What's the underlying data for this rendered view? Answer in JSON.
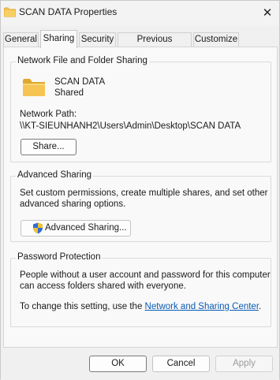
{
  "window": {
    "title": "SCAN DATA Properties",
    "close_glyph": "✕"
  },
  "tabs": [
    {
      "label": "General",
      "active": false
    },
    {
      "label": "Sharing",
      "active": true
    },
    {
      "label": "Security",
      "active": false
    },
    {
      "label": "Previous Versions",
      "active": false
    },
    {
      "label": "Customize",
      "active": false
    }
  ],
  "network_sharing": {
    "group_title": "Network File and Folder Sharing",
    "folder_name": "SCAN DATA",
    "share_status": "Shared",
    "network_path_label": "Network Path:",
    "network_path": "\\\\KT-SIEUNHANH2\\Users\\Admin\\Desktop\\SCAN DATA",
    "share_button": "Share..."
  },
  "advanced_sharing": {
    "group_title": "Advanced Sharing",
    "description_line1": "Set custom permissions, create multiple shares, and set other",
    "description_line2": "advanced sharing options.",
    "button": "Advanced Sharing..."
  },
  "password_protection": {
    "group_title": "Password Protection",
    "description_line1": "People without a user account and password for this computer",
    "description_line2": "can access folders shared with everyone.",
    "change_prefix": "To change this setting, use the ",
    "link": "Network and Sharing Center",
    "change_suffix": "."
  },
  "footer": {
    "ok": "OK",
    "cancel": "Cancel",
    "apply": "Apply"
  },
  "colors": {
    "folder": "#f6c453",
    "folder_dark": "#e0a82e",
    "link": "#0a5bb3",
    "shield_blue": "#2f6fd6",
    "shield_yellow": "#f2c230"
  },
  "icons": {
    "title": "folder-icon",
    "folder": "folder-icon",
    "uac": "uac-shield-icon",
    "close": "close-icon"
  }
}
